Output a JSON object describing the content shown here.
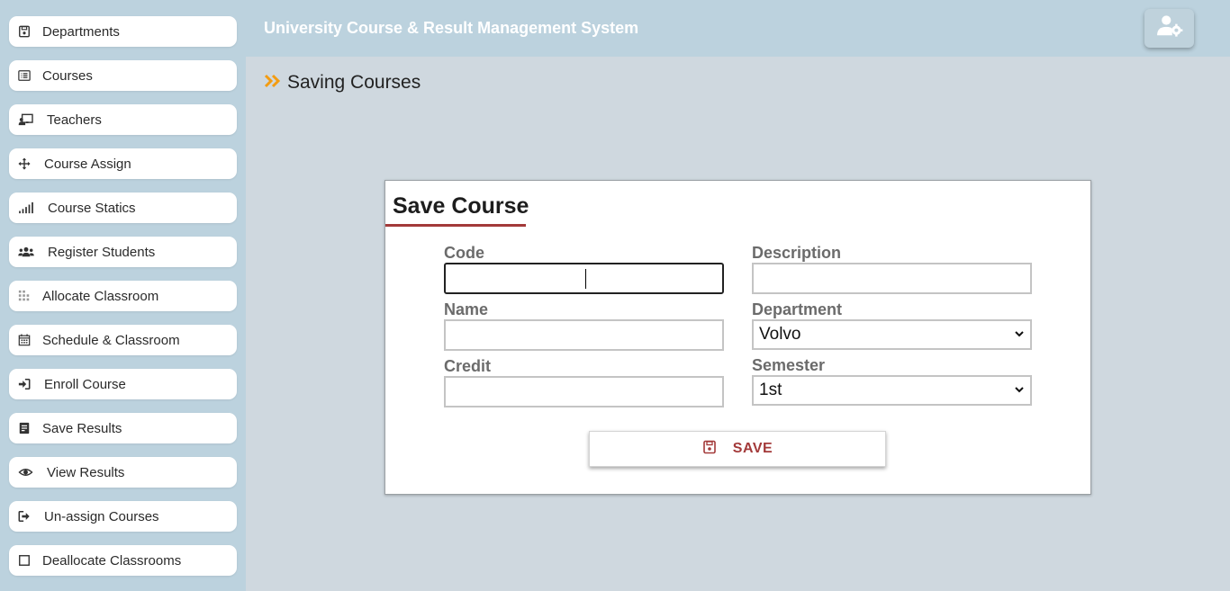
{
  "sidebar": {
    "items": [
      {
        "label": "Departments",
        "icon": "floppy-icon"
      },
      {
        "label": "Courses",
        "icon": "list-icon"
      },
      {
        "label": "Teachers",
        "icon": "chalkboard-teacher-icon"
      },
      {
        "label": "Course Assign",
        "icon": "arrows-move-icon"
      },
      {
        "label": "Course Statics",
        "icon": "signal-bars-icon"
      },
      {
        "label": "Register Students",
        "icon": "users-icon"
      },
      {
        "label": "Allocate Classroom",
        "icon": "grid-icon"
      },
      {
        "label": "Schedule & Classroom",
        "icon": "calendar-icon"
      },
      {
        "label": "Enroll Course",
        "icon": "sign-in-icon"
      },
      {
        "label": "Save Results",
        "icon": "file-text-icon"
      },
      {
        "label": "View Results",
        "icon": "eye-icon"
      },
      {
        "label": "Un-assign Courses",
        "icon": "sign-out-icon"
      },
      {
        "label": "Deallocate Classrooms",
        "icon": "square-icon"
      }
    ]
  },
  "header": {
    "title": "University Course & Result Management System",
    "user_icon": "user-gear-icon"
  },
  "page": {
    "heading": "Saving Courses",
    "heading_icon": "double-chevron-right-icon"
  },
  "form": {
    "title": "Save Course",
    "code_label": "Code",
    "code_value": "",
    "name_label": "Name",
    "name_value": "",
    "credit_label": "Credit",
    "credit_value": "",
    "description_label": "Description",
    "description_value": "",
    "department_label": "Department",
    "department_value": "Volvo",
    "semester_label": "Semester",
    "semester_value": "1st",
    "save_label": "SAVE"
  },
  "colors": {
    "sidebar_bg": "#bcd2de",
    "content_bg": "#cfd8df",
    "accent_red": "#a33a3a",
    "accent_orange": "#f39c12"
  }
}
